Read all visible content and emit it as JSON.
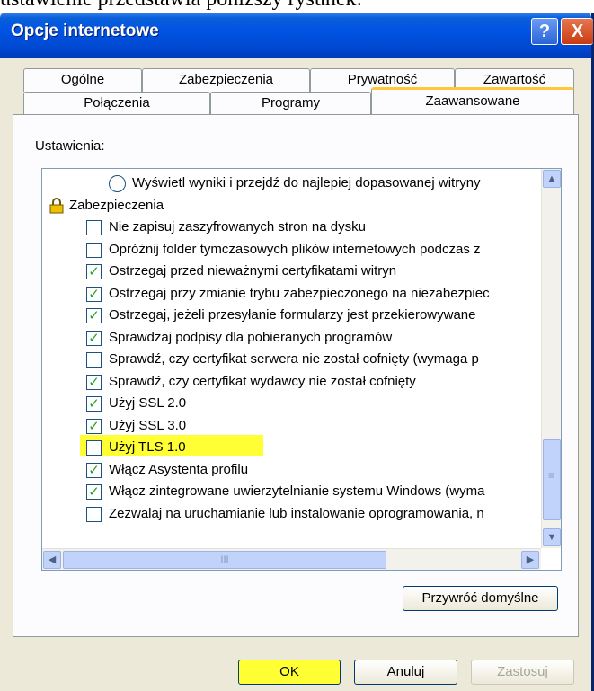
{
  "doc_text": "ustawienie przedstawia poniższy rysunek:",
  "window": {
    "title": "Opcje internetowe",
    "help_label": "?",
    "close_label": "X"
  },
  "tabs_row1": [
    "Ogólne",
    "Zabezpieczenia",
    "Prywatność",
    "Zawartość"
  ],
  "tabs_row2": [
    "Połączenia",
    "Programy",
    "Zaawansowane"
  ],
  "settings_label": "Ustawienia:",
  "settings_items": [
    {
      "type": "radio",
      "label": "Wyświetl wyniki i przejdź do najlepiej dopasowanej witryny",
      "checked": false
    },
    {
      "type": "group",
      "label": "Zabezpieczenia",
      "icon": "lock-icon"
    },
    {
      "type": "checkbox",
      "label": "Nie zapisuj zaszyfrowanych stron na dysku",
      "checked": false
    },
    {
      "type": "checkbox",
      "label": "Opróżnij folder tymczasowych plików internetowych podczas z",
      "checked": false
    },
    {
      "type": "checkbox",
      "label": "Ostrzegaj przed nieważnymi certyfikatami witryn",
      "checked": true
    },
    {
      "type": "checkbox",
      "label": "Ostrzegaj przy zmianie trybu zabezpieczonego na niezabezpiec",
      "checked": true
    },
    {
      "type": "checkbox",
      "label": "Ostrzegaj, jeżeli przesyłanie formularzy jest przekierowywane",
      "checked": true
    },
    {
      "type": "checkbox",
      "label": "Sprawdzaj podpisy dla pobieranych programów",
      "checked": true
    },
    {
      "type": "checkbox",
      "label": "Sprawdź, czy certyfikat serwera nie został cofnięty (wymaga p",
      "checked": false
    },
    {
      "type": "checkbox",
      "label": "Sprawdź, czy certyfikat wydawcy nie został cofnięty",
      "checked": true
    },
    {
      "type": "checkbox",
      "label": "Użyj SSL 2.0",
      "checked": true
    },
    {
      "type": "checkbox",
      "label": "Użyj SSL 3.0",
      "checked": true,
      "highlighted": true
    },
    {
      "type": "checkbox",
      "label": "Użyj TLS 1.0",
      "checked": false
    },
    {
      "type": "checkbox",
      "label": "Włącz Asystenta profilu",
      "checked": true
    },
    {
      "type": "checkbox",
      "label": "Włącz zintegrowane uwierzytelnianie systemu Windows (wyma",
      "checked": true
    },
    {
      "type": "checkbox",
      "label": "Zezwalaj na uruchamianie lub instalowanie oprogramowania, n",
      "checked": false
    }
  ],
  "check_glyph": "✓",
  "scroll_glyphs": {
    "up": "▲",
    "down": "▼",
    "left": "◀",
    "right": "▶",
    "grip_v": "≡",
    "grip_h": "III"
  },
  "buttons": {
    "restore": "Przywróć domyślne",
    "ok": "OK",
    "cancel": "Anuluj",
    "apply": "Zastosuj"
  },
  "colors": {
    "titlebar": "#0054e3",
    "highlight": "#ffff33",
    "checkmark": "#21a121",
    "active_tab": "#ffc83c"
  }
}
